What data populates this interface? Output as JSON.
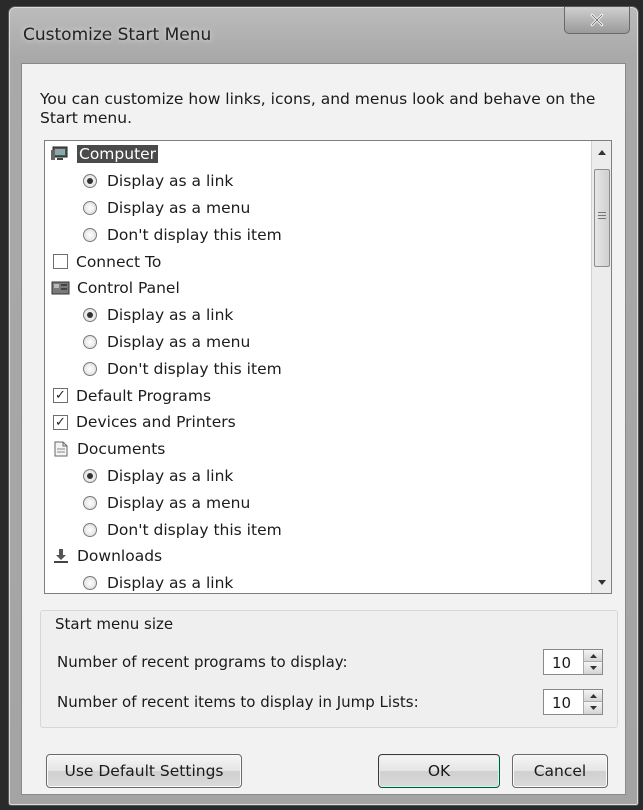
{
  "window": {
    "title": "Customize Start Menu",
    "close_label": "✕"
  },
  "intro": "You can customize how links, icons, and menus look and behave on the Start menu.",
  "list": {
    "rows": [
      {
        "kind": "cat",
        "icon": "computer-icon",
        "label": "Computer",
        "selected": true
      },
      {
        "kind": "opt",
        "checked": true,
        "label": "Display as a link"
      },
      {
        "kind": "opt",
        "checked": false,
        "label": "Display as a menu"
      },
      {
        "kind": "opt",
        "checked": false,
        "label": "Don't display this item"
      },
      {
        "kind": "check",
        "checked": false,
        "label": "Connect To"
      },
      {
        "kind": "cat",
        "icon": "control-panel-icon",
        "label": "Control Panel"
      },
      {
        "kind": "opt",
        "checked": true,
        "label": "Display as a link"
      },
      {
        "kind": "opt",
        "checked": false,
        "label": "Display as a menu"
      },
      {
        "kind": "opt",
        "checked": false,
        "label": "Don't display this item"
      },
      {
        "kind": "check",
        "checked": true,
        "label": "Default Programs"
      },
      {
        "kind": "check",
        "checked": true,
        "label": "Devices and Printers"
      },
      {
        "kind": "cat",
        "icon": "documents-icon",
        "label": "Documents"
      },
      {
        "kind": "opt",
        "checked": true,
        "label": "Display as a link"
      },
      {
        "kind": "opt",
        "checked": false,
        "label": "Display as a menu"
      },
      {
        "kind": "opt",
        "checked": false,
        "label": "Don't display this item"
      },
      {
        "kind": "cat",
        "icon": "downloads-icon",
        "label": "Downloads"
      },
      {
        "kind": "opt",
        "checked": false,
        "label": "Display as a link"
      }
    ]
  },
  "start_menu_size": {
    "label": "Start menu size",
    "recent_programs_label": "Number of recent programs to display:",
    "recent_programs_value": "10",
    "jump_list_label": "Number of recent items to display in Jump Lists:",
    "jump_list_value": "10"
  },
  "buttons": {
    "default_settings": "Use Default Settings",
    "ok": "OK",
    "cancel": "Cancel"
  }
}
